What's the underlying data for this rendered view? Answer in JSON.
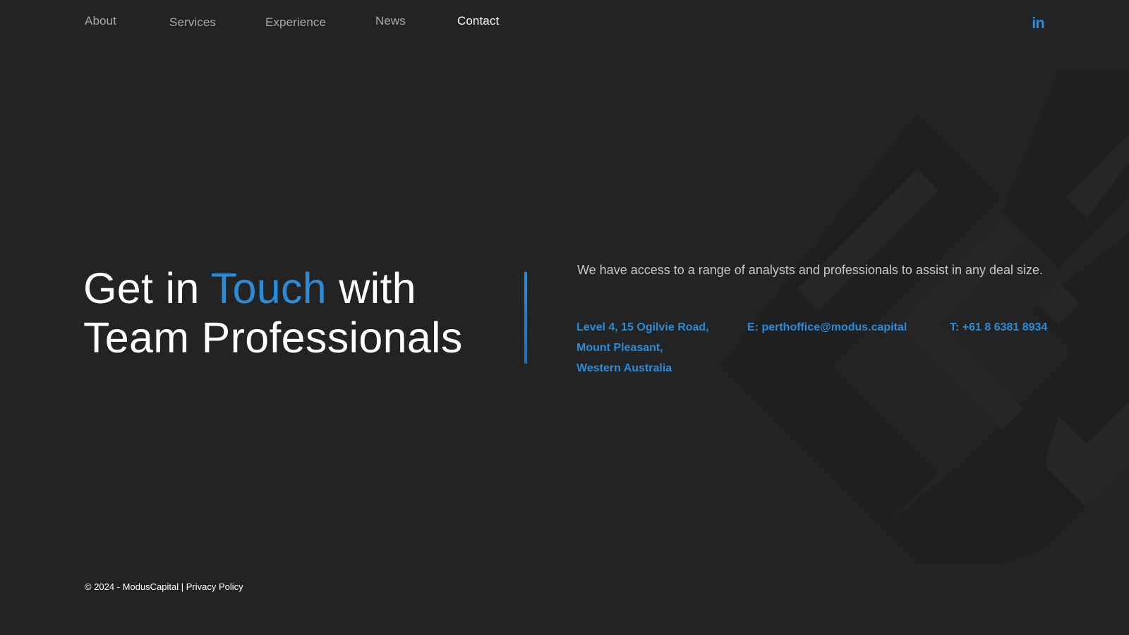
{
  "nav": {
    "items": [
      {
        "label": "About"
      },
      {
        "label": "Services"
      },
      {
        "label": "Experience"
      },
      {
        "label": "News"
      },
      {
        "label": "Contact",
        "active": true
      }
    ],
    "social_icon": "linkedin-icon",
    "social_label": "in"
  },
  "hero": {
    "title_part1": "Get in",
    "title_accent": "Touch",
    "title_part2": "with",
    "title_line2": "Team Professionals"
  },
  "intro_text": "We have access to a range of analysts and professionals to assist in any deal size.",
  "contact": {
    "address_lines": [
      "Level 4, 15 Ogilvie Road,",
      "Mount Pleasant,",
      "Western Australia"
    ],
    "email": "E: perthoffice@modus.capital",
    "phone": "T: +61 8 6381 8934"
  },
  "footer": {
    "copyright": "© 2024 - ModusCapital | ",
    "privacy_label": "Privacy Policy"
  },
  "colors": {
    "background": "#232323",
    "accent": "#2b8bd6",
    "text": "#ffffff",
    "nav_muted": "#a9a9a9"
  }
}
